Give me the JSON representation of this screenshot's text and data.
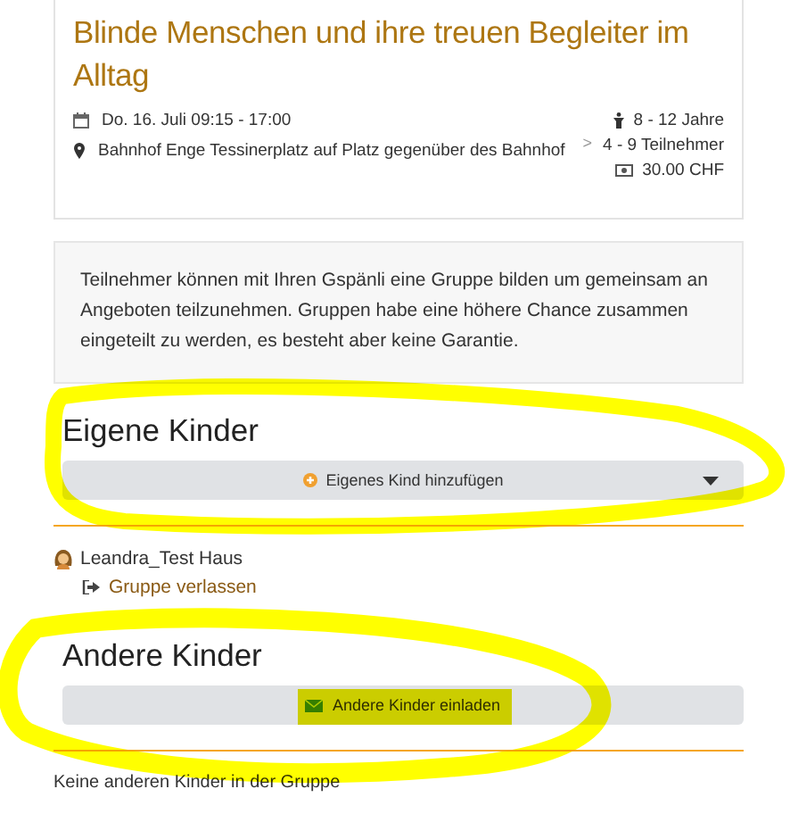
{
  "event": {
    "title": "Blinde Menschen und ihre treuen Begleiter im Alltag",
    "date": "Do. 16. Juli 09:15 - 17:00",
    "location": "Bahnhof Enge Tessinerplatz auf Platz gegenüber des Bahnhof",
    "chevron": ">",
    "age": "8 - 12 Jahre",
    "participants": "4 - 9 Teilnehmer",
    "price": "30.00 CHF"
  },
  "info": "Teilnehmer können mit Ihren Gspänli eine Gruppe bilden um gemeinsam an Angeboten teilzunehmen. Gruppen habe eine höhere Chance zusammen eingeteilt zu werden, es besteht aber keine Garantie.",
  "own_children": {
    "heading": "Eigene Kinder",
    "button": "Eigenes Kind hinzufügen",
    "children": [
      {
        "name": "Leandra_Test Haus",
        "action": "Gruppe verlassen"
      }
    ]
  },
  "other_children": {
    "heading": "Andere Kinder",
    "button": "Andere Kinder einladen",
    "empty_text": "Keine anderen Kinder in der Gruppe"
  }
}
